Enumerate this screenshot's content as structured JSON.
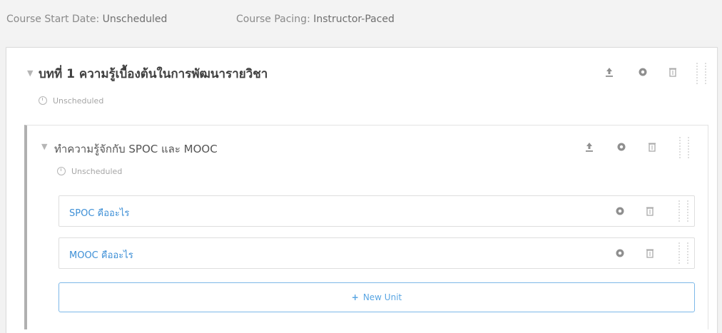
{
  "course_meta": {
    "start_label": "Course Start Date:",
    "start_value": "Unscheduled",
    "pacing_label": "Course Pacing:",
    "pacing_value": "Instructor-Paced"
  },
  "section": {
    "title": "บทที่ 1 ความรู้เบื้องต้นในการพัฒนารายวิชา",
    "status": "Unscheduled"
  },
  "subsection": {
    "title": "ทำความรู้จักกับ SPOC และ MOOC",
    "status": "Unscheduled"
  },
  "units": [
    {
      "label": "SPOC คืออะไร"
    },
    {
      "label": "MOOC คืออะไร"
    }
  ],
  "new_unit": {
    "label": "New Unit"
  },
  "colors": {
    "link": "#3d8fd6",
    "new_unit_border": "#7db8e8"
  }
}
